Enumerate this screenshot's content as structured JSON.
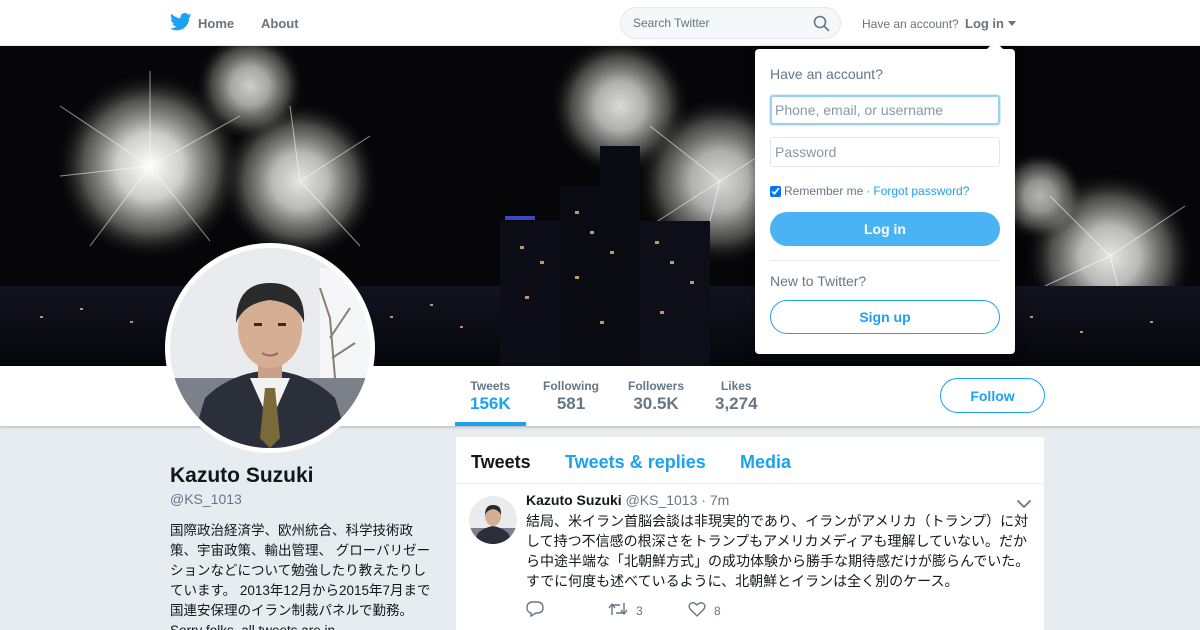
{
  "nav": {
    "home_label": "Home",
    "about_label": "About",
    "search_placeholder": "Search Twitter",
    "have_account": "Have an account?",
    "login_label": "Log in"
  },
  "brand": {
    "accent": "#1da1f2"
  },
  "profile": {
    "name": "Kazuto Suzuki",
    "handle": "@KS_1013",
    "bio": "国際政治経済学、欧州統合、科学技術政策、宇宙政策、輸出管理、 グローバリゼーションなどについて勉強したり教えたりしています。 2013年12月から2015年7月まで国連安保理のイラン制裁パネルで勤務。 Sorry folks, all tweets are in"
  },
  "stats": [
    {
      "label": "Tweets",
      "value": "156K"
    },
    {
      "label": "Following",
      "value": "581"
    },
    {
      "label": "Followers",
      "value": "30.5K"
    },
    {
      "label": "Likes",
      "value": "3,274"
    }
  ],
  "follow_label": "Follow",
  "tabs": [
    {
      "label": "Tweets"
    },
    {
      "label": "Tweets & replies"
    },
    {
      "label": "Media"
    }
  ],
  "tweet": {
    "name": "Kazuto Suzuki",
    "handle": "@KS_1013",
    "separator": "·",
    "time": "7m",
    "text": "結局、米イラン首脳会談は非現実的であり、イランがアメリカ（トランプ）に対して持つ不信感の根深さをトランプもアメリカメディアも理解していない。だから中途半端な「北朝鮮方式」の成功体験から勝手な期待感だけが膨らんでいた。すでに何度も述べているように、北朝鮮とイランは全く別のケース。",
    "retweets": "3",
    "likes": "8"
  },
  "login_dropdown": {
    "title": "Have an account?",
    "username_placeholder": "Phone, email, or username",
    "password_placeholder": "Password",
    "remember_label": "Remember me",
    "separator": "·",
    "forgot_label": "Forgot password?",
    "login_button": "Log in",
    "new_label": "New to Twitter?",
    "signup_button": "Sign up"
  }
}
